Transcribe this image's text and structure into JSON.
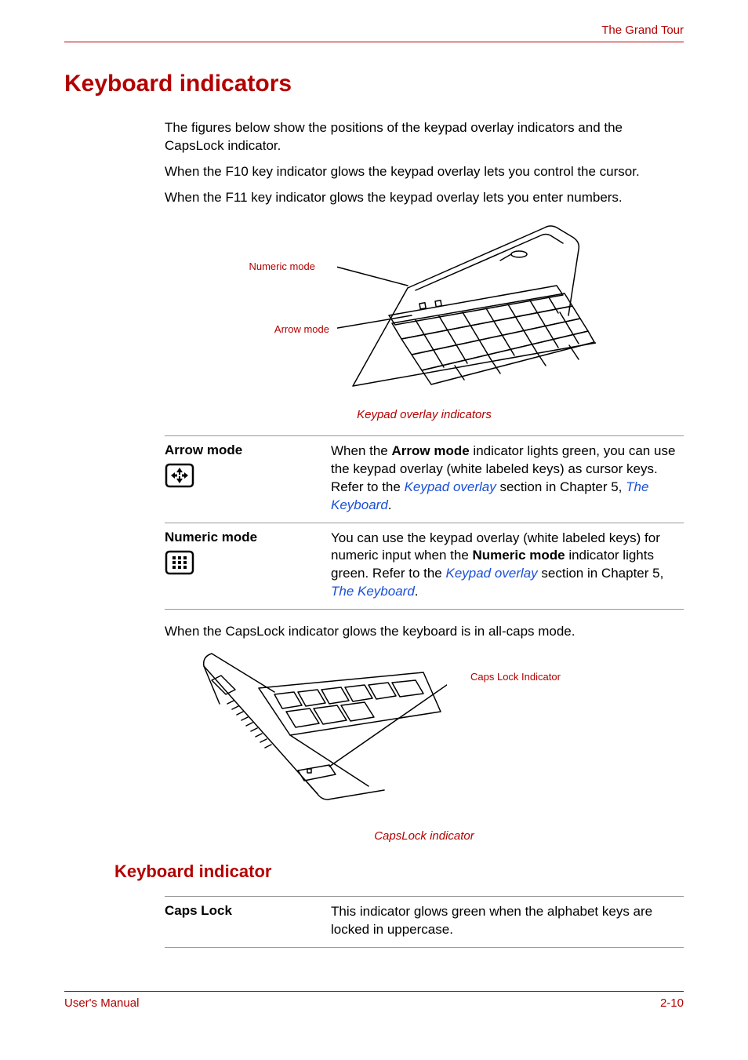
{
  "header": {
    "section": "The Grand Tour"
  },
  "h1": "Keyboard indicators",
  "intro": {
    "p1": "The figures below show the positions of the keypad overlay indicators and the CapsLock indicator.",
    "p2": "When the F10 key indicator glows the keypad overlay lets you control the cursor.",
    "p3": "When the F11 key indicator glows the keypad overlay lets you enter numbers."
  },
  "figure1": {
    "label_numeric": "Numeric mode",
    "label_arrow": "Arrow mode",
    "caption": "Keypad overlay indicators"
  },
  "defs": {
    "arrow": {
      "term": "Arrow mode",
      "desc_pre": "When the ",
      "desc_bold": "Arrow mode",
      "desc_mid": " indicator lights green, you can use the keypad overlay (white labeled keys) as cursor keys. Refer to the ",
      "link1": "Keypad overlay",
      "desc_mid2": " section in Chapter 5, ",
      "link2": "The Keyboard",
      "desc_end": "."
    },
    "numeric": {
      "term": "Numeric mode",
      "desc_pre": "You can use the keypad overlay (white labeled keys) for numeric input when the ",
      "desc_bold": "Numeric mode",
      "desc_mid": " indicator lights green. Refer to the ",
      "link1": "Keypad overlay",
      "desc_mid2": " section in Chapter 5, ",
      "link2": "The Keyboard",
      "desc_end": "."
    }
  },
  "para_after": "When the CapsLock indicator glows the keyboard is in all-caps mode.",
  "figure2": {
    "label_caps": "Caps Lock Indicator",
    "caption": "CapsLock indicator"
  },
  "h2": "Keyboard indicator",
  "defs2": {
    "caps": {
      "term": "Caps Lock",
      "desc": "This indicator glows green when the alphabet keys are locked in uppercase."
    }
  },
  "footer": {
    "left": "User's Manual",
    "right": "2-10"
  }
}
